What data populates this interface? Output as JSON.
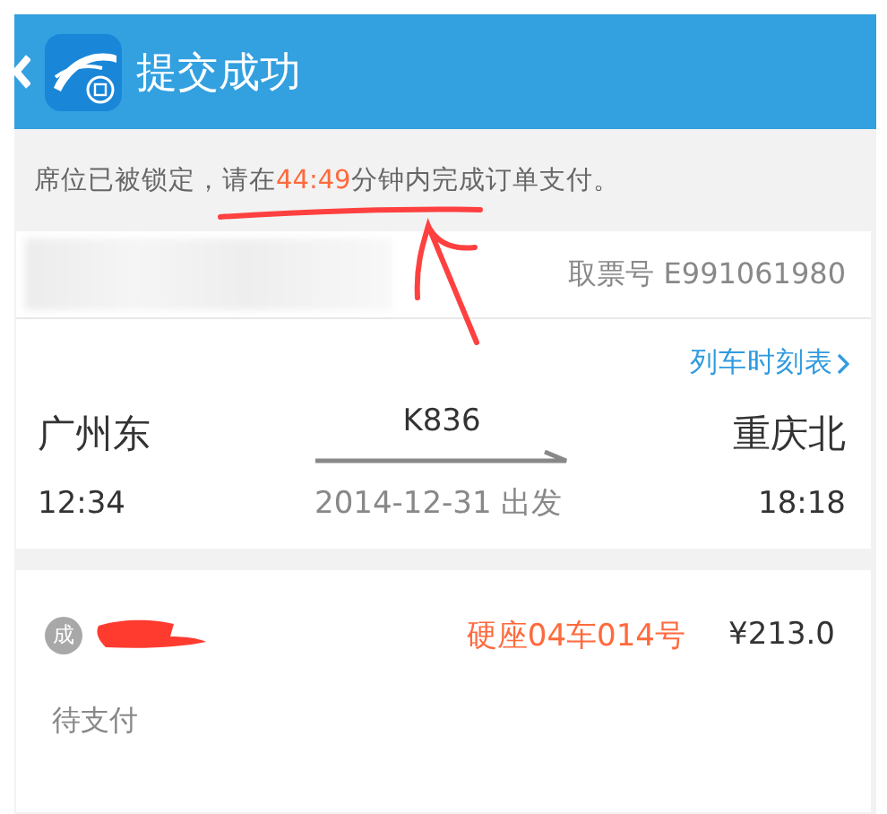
{
  "header": {
    "title": "提交成功"
  },
  "notice": {
    "before": "席位已被锁定，请在",
    "countdown": "44:49",
    "after": "分钟内完成订单支付。"
  },
  "ticket": {
    "pickup": "取票号 E991061980",
    "timetable_link": "列车时刻表",
    "from_station": "广州东",
    "to_station": "重庆北",
    "train_no": "K836",
    "depart_time": "12:34",
    "arrive_time": "18:18",
    "date": "2014-12-31 出发"
  },
  "passenger": {
    "badge": "成",
    "seat": "硬座04车014号",
    "price": "¥213.0",
    "status": "待支付"
  }
}
